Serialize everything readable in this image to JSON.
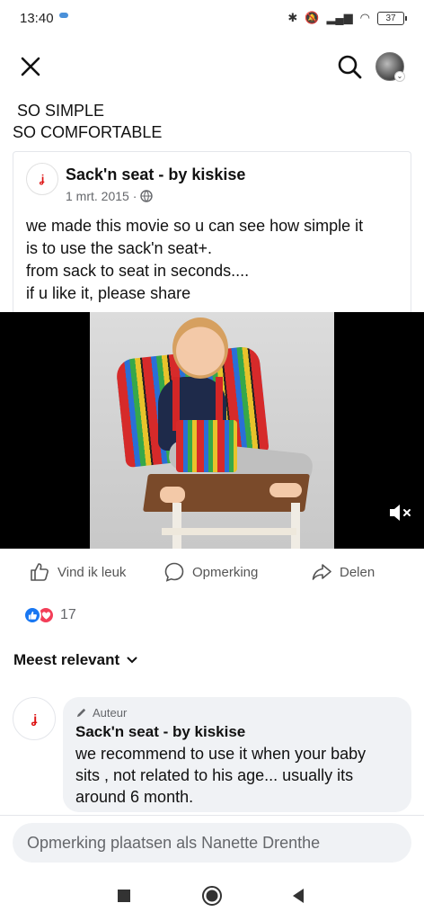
{
  "status_bar": {
    "time": "13:40",
    "battery": "37"
  },
  "shared_post": {
    "line1": "SO SIMPLE",
    "line2": "SO COMFORTABLE"
  },
  "post": {
    "page_name": "Sack'n seat - by kiskise",
    "date": "1 mrt. 2015 ·",
    "body": [
      "we made this movie so u can see how simple it",
      "is to use the sack'n seat+.",
      "from sack to seat in seconds....",
      "if u like it, please share"
    ],
    "avatar_text": "Sack'n Seat"
  },
  "actions": {
    "like": "Vind ik leuk",
    "comment": "Opmerking",
    "share": "Delen"
  },
  "reactions": {
    "count": "17"
  },
  "comments_sort": {
    "label": "Meest relevant"
  },
  "comment": {
    "badge": "Auteur",
    "author": "Sack'n seat - by kiskise",
    "text": [
      "we recommend to use it when your baby",
      "sits , not  related  to his age... usually its",
      "around 6 month."
    ]
  },
  "composer": {
    "placeholder": "Opmerking plaatsen als Nanette Drenthe"
  },
  "colors": {
    "like_blue": "#1877f2",
    "love_red": "#f33e58",
    "meta_gray": "#65676b"
  },
  "icons": [
    "close-icon",
    "search-icon",
    "globe-icon",
    "mute-icon",
    "like-icon",
    "comment-icon",
    "share-icon",
    "pencil-icon",
    "chevron-down-icon"
  ]
}
